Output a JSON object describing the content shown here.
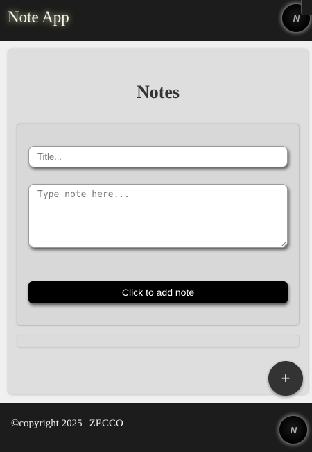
{
  "header": {
    "title": "Note App",
    "logo_text": "N"
  },
  "main": {
    "heading": "Notes",
    "title_placeholder": "Title...",
    "note_placeholder": "Type note here...",
    "add_button_label": "Click to add note",
    "fab_label": "+"
  },
  "footer": {
    "copyright": "©copyright 2025",
    "company": "ZECCO",
    "logo_text": "N"
  },
  "colors": {
    "header_bg": "#1c1c1c",
    "card_bg": "#dedede",
    "button_bg": "#000000",
    "fab_bg": "#333333"
  },
  "icons": {
    "logo": "n-logo-icon",
    "fab": "plus-icon"
  }
}
